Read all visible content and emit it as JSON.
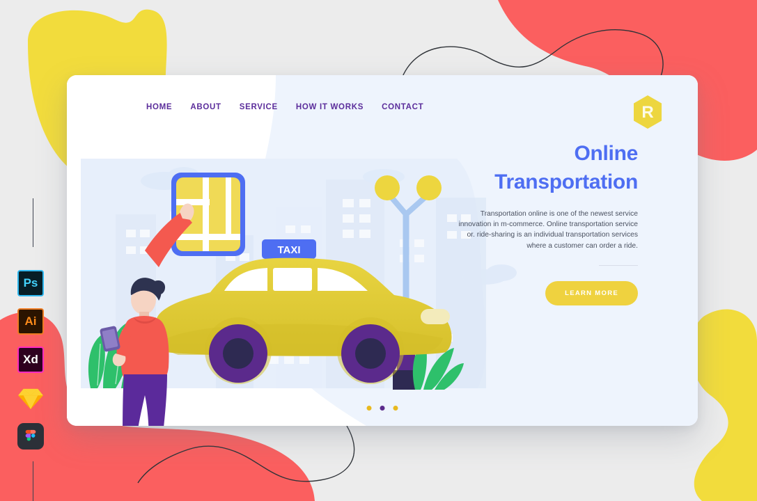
{
  "palette": {
    "page_bg": "#ececec",
    "blob_yellow": "#f2dc3c",
    "blob_coral": "#fb5f5f",
    "card_white": "#ffffff",
    "card_tint": "#eef4fd",
    "nav_purple": "#5b2d9b",
    "headline_blue": "#4e6ef2",
    "body_gray": "#4a5160",
    "cta_yellow": "#efd23f",
    "taxi_yellow": "#e3ce33",
    "wheel_purple": "#5b2a8c",
    "hoodie_coral": "#f4594f",
    "pants_purple": "#5b2a9b",
    "plant_green": "#2ec06b",
    "lamp_blue": "#a9c8f0",
    "dot_yellow": "#e8b91f",
    "dot_purple": "#5b2a8c"
  },
  "nav": {
    "items": [
      {
        "label": "HOME"
      },
      {
        "label": "ABOUT"
      },
      {
        "label": "SERVICE"
      },
      {
        "label": "HOW IT WORKS"
      },
      {
        "label": "CONTACT"
      }
    ]
  },
  "logo": {
    "letter": "R",
    "shape": "hexagon"
  },
  "hero": {
    "headline": "Online\nTransportation",
    "body": "Transportation online is one of the newest service innovation in m-commerce. Online transportation service or. ride-sharing is an individual transportation services where a customer can order a ride.",
    "cta_label": "LEARN MORE"
  },
  "illustration": {
    "taxi_sign_label": "TAXI",
    "elements": [
      "city-skyline",
      "clouds",
      "map-card",
      "person-hailing-taxi",
      "smartphone",
      "yellow-taxi",
      "street-lamp",
      "plants",
      "road"
    ]
  },
  "carousel": {
    "dots": [
      {
        "state": "inactive",
        "color": "#e8b91f"
      },
      {
        "state": "active",
        "color": "#5b2a8c"
      },
      {
        "state": "inactive",
        "color": "#e8b91f"
      }
    ]
  },
  "app_rail": {
    "items": [
      {
        "name": "photoshop",
        "label": "Ps",
        "bg": "#071e26",
        "border": "#2fb8ef",
        "fg": "#43d3fd"
      },
      {
        "name": "illustrator",
        "label": "Ai",
        "bg": "#2b1400",
        "border": "#ef7c22",
        "fg": "#ff8c1a"
      },
      {
        "name": "xd",
        "label": "Xd",
        "bg": "#2e001f",
        "border": "#ff2bc2",
        "fg": "#ffffff"
      },
      {
        "name": "sketch",
        "label": "",
        "bg": "transparent",
        "border": "transparent",
        "fg": "#f7b500"
      },
      {
        "name": "figma",
        "label": "",
        "bg": "#2c3038",
        "border": "transparent",
        "fg": "#ffffff"
      }
    ]
  }
}
